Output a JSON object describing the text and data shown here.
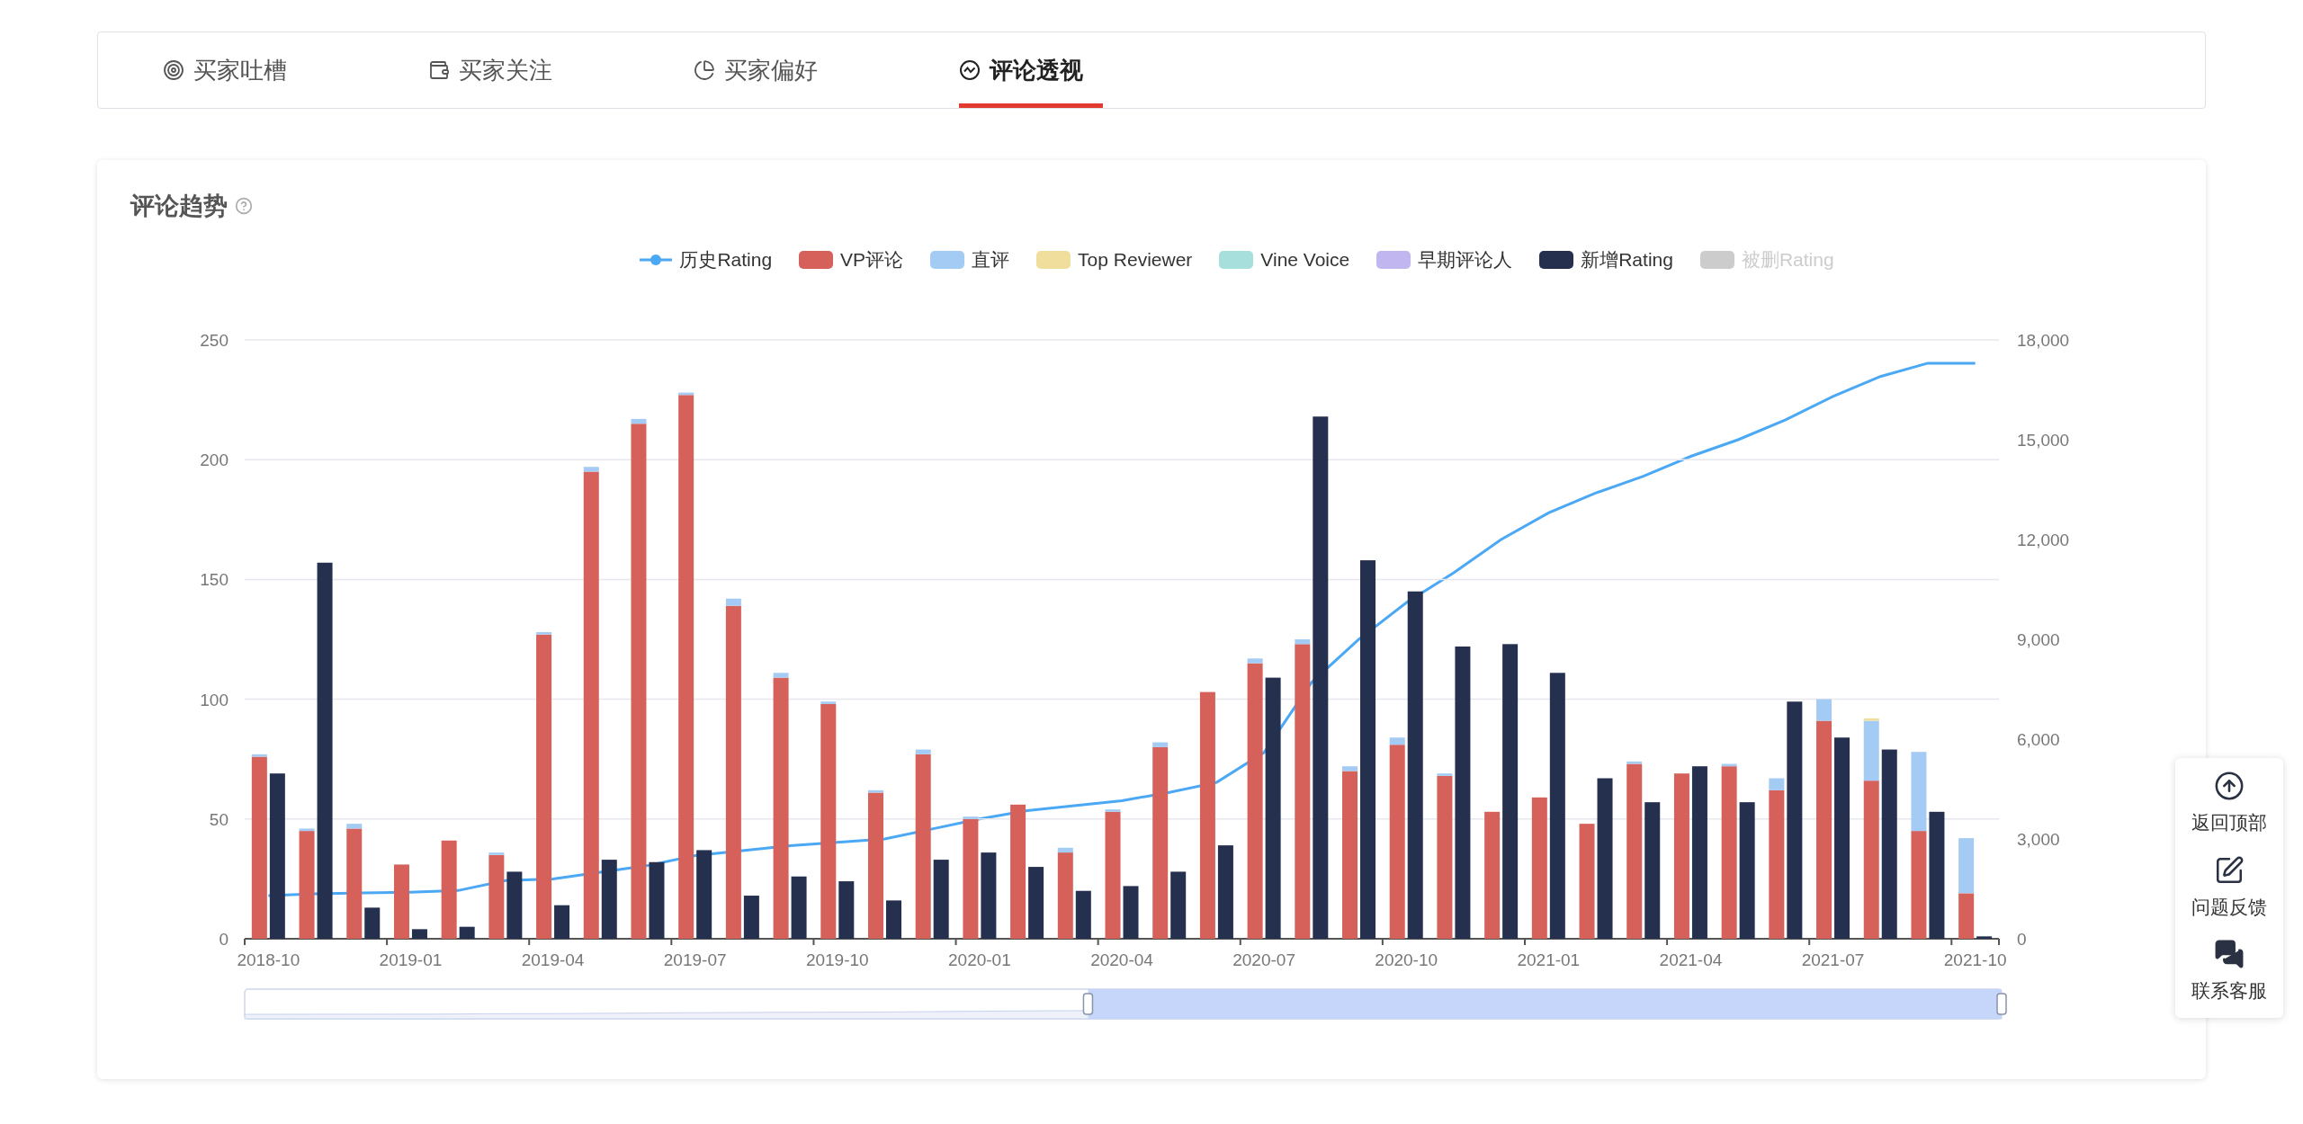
{
  "tabs": [
    {
      "label": "买家吐槽",
      "selected": false
    },
    {
      "label": "买家关注",
      "selected": false
    },
    {
      "label": "买家偏好",
      "selected": false
    },
    {
      "label": "评论透视",
      "selected": true
    }
  ],
  "chart_card": {
    "title": "评论趋势",
    "legend": [
      {
        "selected": true
      },
      {
        "selected": true
      },
      {
        "selected": true
      },
      {
        "selected": true
      },
      {
        "selected": true
      },
      {
        "selected": true
      },
      {
        "selected": true
      },
      {
        "selected": false
      }
    ],
    "charts": [
      {
        "chart_data": {
          "type": "line",
          "categories": [
            null,
            null,
            null,
            null,
            null,
            null,
            null,
            null,
            null,
            null,
            null,
            null,
            null,
            null,
            null,
            null,
            null,
            null,
            null,
            null,
            null,
            null,
            null,
            null,
            null,
            null,
            null,
            null,
            null,
            null,
            null,
            null,
            null,
            null,
            null,
            null,
            null
          ],
          "ylim": [
            0,
            18000
          ],
          "yticks": [
            {
              "value": 0,
              "label": "0"
            },
            {
              "value": 3000,
              "label": "3,000"
            },
            {
              "value": 6000,
              "label": "6,000"
            },
            {
              "value": 9000,
              "label": "9,000"
            },
            {
              "value": 12000,
              "label": "12,000"
            },
            {
              "value": 15000,
              "label": "15,000"
            },
            {
              "value": 18000,
              "label": "18,000"
            }
          ],
          "series": [
            {
              "name": "历史Rating",
              "color": "#4aa8f5",
              "values": [
                1300,
                1350,
                1380,
                1400,
                1450,
                1750,
                1800,
                2000,
                2200,
                2500,
                2650,
                2800,
                2900,
                3000,
                3300,
                3600,
                3850,
                4000,
                4150,
                4400,
                4700,
                5600,
                7700,
                9000,
                10100,
                11000,
                12000,
                12800,
                13400,
                13900,
                14500,
                15000,
                15600,
                16300,
                16900,
                17300,
                17300
              ]
            }
          ]
        }
      },
      {
        "chart_data": {
          "type": "bar",
          "stacked": true,
          "grid": true,
          "categories": [
            "2018-10",
            null,
            null,
            "2019-01",
            null,
            null,
            "2019-04",
            null,
            null,
            "2019-07",
            null,
            null,
            "2019-10",
            null,
            null,
            "2020-01",
            null,
            null,
            "2020-04",
            null,
            null,
            "2020-07",
            null,
            null,
            "2020-10",
            null,
            null,
            "2021-01",
            null,
            null,
            "2021-04",
            null,
            null,
            "2021-07",
            null,
            null,
            "2021-10"
          ],
          "ylim": [
            0,
            250
          ],
          "yticks": [
            0,
            50,
            100,
            150,
            200,
            250
          ],
          "series": [
            {
              "name": "VP评论",
              "color": "#d6615b",
              "values": [
                76,
                45,
                46,
                31,
                41,
                35,
                127,
                195,
                215,
                227,
                139,
                109,
                98,
                61,
                77,
                50,
                56,
                36,
                53,
                80,
                103,
                115,
                123,
                70,
                81,
                68,
                53,
                59,
                48,
                73,
                69,
                72,
                62,
                91,
                66,
                45,
                19
              ]
            },
            {
              "name": "直评",
              "color": "#a4cbf4",
              "values": [
                1,
                1,
                2,
                null,
                null,
                1,
                1,
                2,
                2,
                1,
                3,
                2,
                1,
                1,
                2,
                1,
                null,
                2,
                1,
                2,
                null,
                2,
                2,
                2,
                3,
                1,
                null,
                null,
                null,
                1,
                null,
                1,
                5,
                9,
                25,
                33,
                23
              ]
            },
            {
              "name": "Top Reviewer",
              "color": "#f0df9c",
              "values": [
                null,
                null,
                null,
                null,
                null,
                null,
                null,
                null,
                null,
                null,
                null,
                null,
                null,
                null,
                null,
                null,
                null,
                null,
                null,
                null,
                null,
                null,
                null,
                null,
                null,
                null,
                null,
                null,
                null,
                null,
                null,
                null,
                null,
                null,
                1,
                null,
                null
              ]
            },
            {
              "name": "Vine Voice",
              "color": "#a6dfdc",
              "values": [
                null,
                null,
                null,
                null,
                null,
                null,
                null,
                null,
                null,
                null,
                null,
                null,
                null,
                null,
                null,
                null,
                null,
                null,
                null,
                null,
                null,
                null,
                null,
                null,
                null,
                null,
                null,
                null,
                null,
                null,
                null,
                null,
                null,
                null,
                null,
                null,
                null
              ]
            },
            {
              "name": "早期评论人",
              "color": "#c1b6ef",
              "values": [
                null,
                null,
                null,
                null,
                null,
                null,
                null,
                null,
                null,
                null,
                null,
                null,
                null,
                null,
                null,
                null,
                null,
                null,
                null,
                null,
                null,
                null,
                null,
                null,
                null,
                null,
                null,
                null,
                null,
                null,
                null,
                null,
                null,
                null,
                null,
                null,
                null
              ]
            }
          ]
        }
      },
      {
        "chart_data": {
          "type": "bar",
          "stacked": false,
          "categories": [
            null,
            null,
            null,
            null,
            null,
            null,
            null,
            null,
            null,
            null,
            null,
            null,
            null,
            null,
            null,
            null,
            null,
            null,
            null,
            null,
            null,
            null,
            null,
            null,
            null,
            null,
            null,
            null,
            null,
            null,
            null,
            null,
            null,
            null,
            null,
            null,
            null
          ],
          "ylim": [
            0,
            250
          ],
          "series": [
            {
              "name": "新增Rating",
              "color": "#25304f",
              "values": [
                69,
                157,
                13,
                4,
                5,
                28,
                14,
                33,
                32,
                37,
                18,
                26,
                24,
                16,
                33,
                36,
                30,
                20,
                22,
                28,
                39,
                109,
                218,
                158,
                145,
                122,
                123,
                111,
                67,
                57,
                72,
                57,
                99,
                84,
                79,
                53,
                1
              ]
            },
            {
              "name": "被删Rating",
              "color": "#cccccc",
              "values": [
                null,
                null,
                null,
                null,
                null,
                null,
                null,
                null,
                null,
                null,
                null,
                null,
                null,
                null,
                null,
                null,
                null,
                null,
                null,
                null,
                null,
                null,
                null,
                null,
                null,
                null,
                null,
                null,
                null,
                null,
                null,
                null,
                null,
                null,
                null,
                null,
                null
              ]
            }
          ]
        }
      }
    ],
    "data_zoom": {
      "level": 0.52
    }
  },
  "side_tools": [
    {
      "label": "返回顶部"
    },
    {
      "label": "问题反馈"
    },
    {
      "label": "联系客服"
    }
  ]
}
